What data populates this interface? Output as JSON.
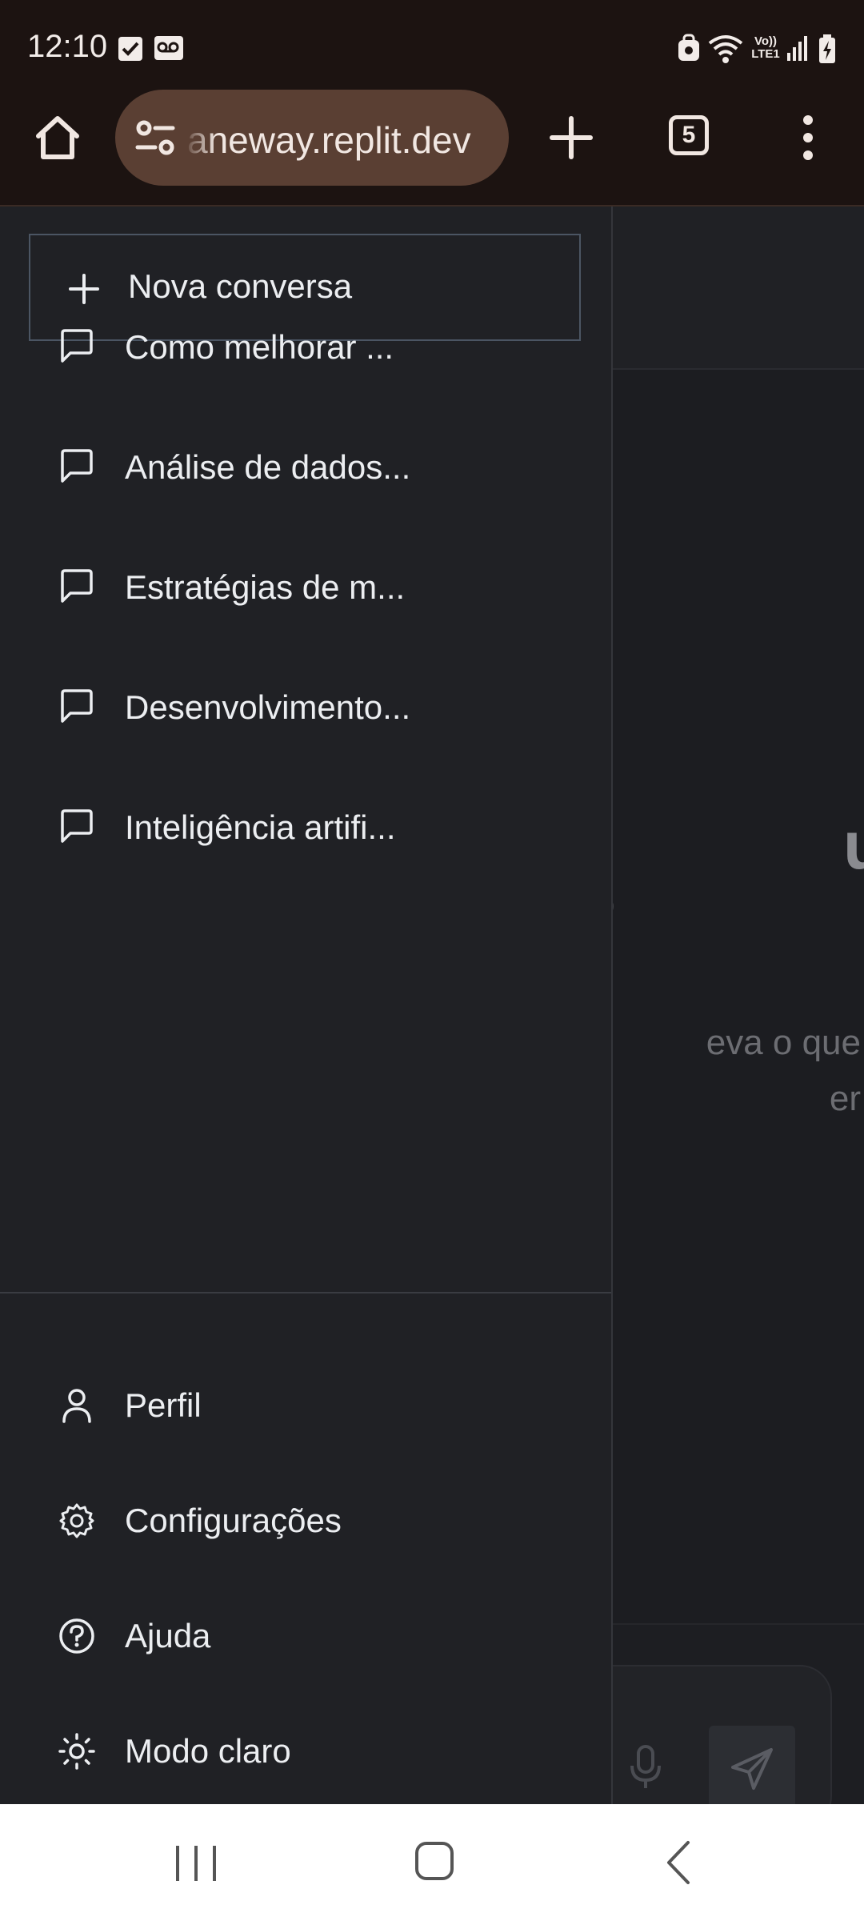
{
  "status_bar": {
    "time": "12:10",
    "left_icons": [
      "checkbox-notification-icon",
      "voicemail-icon"
    ],
    "right_icons": [
      "vpn-icon",
      "wifi-icon",
      "volte-icon",
      "signal-icon",
      "battery-charging-icon"
    ],
    "volte_label_top": "Vo))",
    "volte_label_bottom": "LTE1"
  },
  "browser": {
    "url": "aneway.replit.dev",
    "tab_count": "5"
  },
  "drawer": {
    "new_chat_label": "Nova conversa",
    "conversations": [
      {
        "label": "Como melhorar ..."
      },
      {
        "label": "Análise de dados..."
      },
      {
        "label": "Estratégias de m..."
      },
      {
        "label": "Desenvolvimento..."
      },
      {
        "label": "Inteligência artifi..."
      }
    ],
    "menu": [
      {
        "label": "Perfil",
        "icon": "user-icon"
      },
      {
        "label": "Configurações",
        "icon": "gear-icon"
      },
      {
        "label": "Ajuda",
        "icon": "help-circle-icon"
      },
      {
        "label": "Modo claro",
        "icon": "sun-icon"
      }
    ]
  },
  "main": {
    "heading_partial": "udar",
    "subheading_partial": "o",
    "description_partial": "eva o que\ner"
  },
  "colors": {
    "browser_chrome": "#1c1311",
    "url_pill": "#5a3f33",
    "drawer_bg": "#202125",
    "text": "#eceef1"
  }
}
